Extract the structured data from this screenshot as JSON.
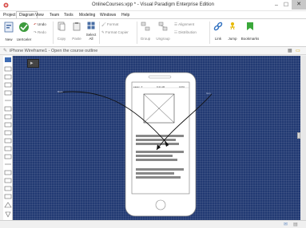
{
  "window": {
    "title": "OnlineCourses.vpp * - Visual Paradigm Enterprise Edition",
    "minimize": "–",
    "maximize": "☐",
    "close": "✕"
  },
  "menu": {
    "items": [
      "Project",
      "Diagram",
      "View",
      "Team",
      "Tools",
      "Modeling",
      "Windows",
      "Help"
    ],
    "active": "Diagram"
  },
  "ribbon": {
    "new": "New",
    "uekeeper": "UeXceler",
    "undo": "Undo",
    "redo": "Redo",
    "copy": "Copy",
    "paste": "Paste",
    "select_all_1": "Select",
    "select_all_2": "All",
    "format": "Format",
    "format_copier": "Format Copier",
    "group": "Group",
    "ungroup": "Ungroup",
    "alignment": "Alignment",
    "distribution": "Distribution",
    "link": "Link",
    "jump": "Jump",
    "bookmarks": "Bookmarks"
  },
  "diagram_tab": {
    "label": "iPhone Wireframe1 - Open the course outline"
  },
  "phone": {
    "carrier": "●●●●○ ✦",
    "time": "9:41 AM",
    "battery": "100%",
    "left_label": "Back",
    "right_label": "Icon"
  },
  "colors": {
    "canvas": "#223a73",
    "ribbon_bg": "#ffffff",
    "close_bg": "#c8c8c8"
  }
}
